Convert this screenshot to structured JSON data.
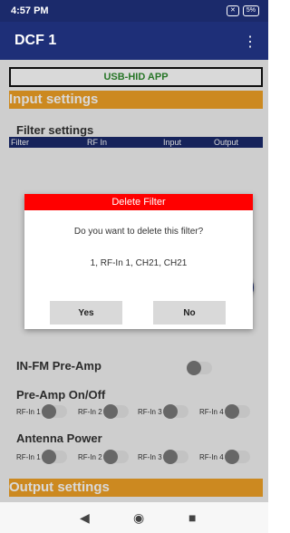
{
  "status_bar": {
    "time": "4:57 PM",
    "icons": [
      "✕",
      "5%"
    ]
  },
  "app_bar": {
    "title": "DCF 1",
    "menu_icon": "more-vert-icon"
  },
  "content": {
    "usb_hid": "USB-HID APP",
    "input_settings": "Input settings",
    "filter_settings": "Filter settings",
    "filter_headers": [
      "Filter",
      "RF In",
      "Input",
      "Output"
    ],
    "infm_preamp": "IN-FM Pre-Amp",
    "preamp_onoff": "Pre-Amp On/Off",
    "antenna_power": "Antenna Power",
    "rf_labels": [
      "RF-In 1",
      "RF-In 2",
      "RF-In 3",
      "RF-In 4"
    ],
    "output_settings": "Output settings"
  },
  "dialog": {
    "title": "Delete Filter",
    "question": "Do you want to delete this filter?",
    "detail": "1, RF-In 1, CH21, CH21",
    "yes": "Yes",
    "no": "No"
  },
  "nav": {
    "back_icon": "◀",
    "home_icon": "◉",
    "recent_icon": "■"
  }
}
